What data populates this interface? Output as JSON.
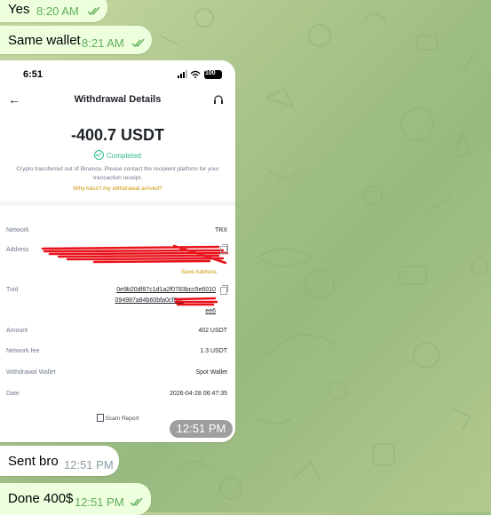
{
  "chat": {
    "messages": [
      {
        "text": "Yes",
        "time": "8:20 AM",
        "direction": "out",
        "read": true
      },
      {
        "text": "Same wallet",
        "time": "8:21 AM",
        "direction": "out",
        "read": true
      },
      {
        "type": "photo",
        "time": "12:51 PM",
        "direction": "in"
      },
      {
        "text": "Sent bro",
        "time": "12:51 PM",
        "direction": "in"
      },
      {
        "text": "Done 400$",
        "time": "12:51 PM",
        "direction": "out",
        "read": true
      }
    ]
  },
  "screenshot": {
    "status_time": "6:51",
    "battery": "100",
    "title": "Withdrawal Details",
    "amount": "-400.7 USDT",
    "status": "Completed",
    "description": "Crypto transferred out of Binance. Please contact the recipient platform for your transaction receipt.",
    "why_link": "Why hasn't my withdrawal arrived?",
    "rows": {
      "network_label": "Network",
      "network_value": "TRX",
      "address_label": "Address",
      "save_address": "Save Address",
      "txid_label": "Txid",
      "txid_line1": "0e9b20df87c1d1a2f0783bcc5e6010",
      "txid_line2": "094987a84b60bfa0cf8ae",
      "txid_line3": "ee6",
      "amount_label": "Amount",
      "amount_value": "402 USDT",
      "fee_label": "Network fee",
      "fee_value": "1.3 USDT",
      "wallet_label": "Withdrawal Wallet",
      "wallet_value": "Spot Wallet",
      "date_label": "Date",
      "date_value": "2026-04-28 06:47:35"
    },
    "scam_report": "Scam Report"
  },
  "colors": {
    "outgoing_bubble": "#eeffde",
    "incoming_bubble": "#ffffff",
    "binance_yellow": "#c99400",
    "completed_green": "#2ebd85",
    "redaction": "#e8121b"
  }
}
